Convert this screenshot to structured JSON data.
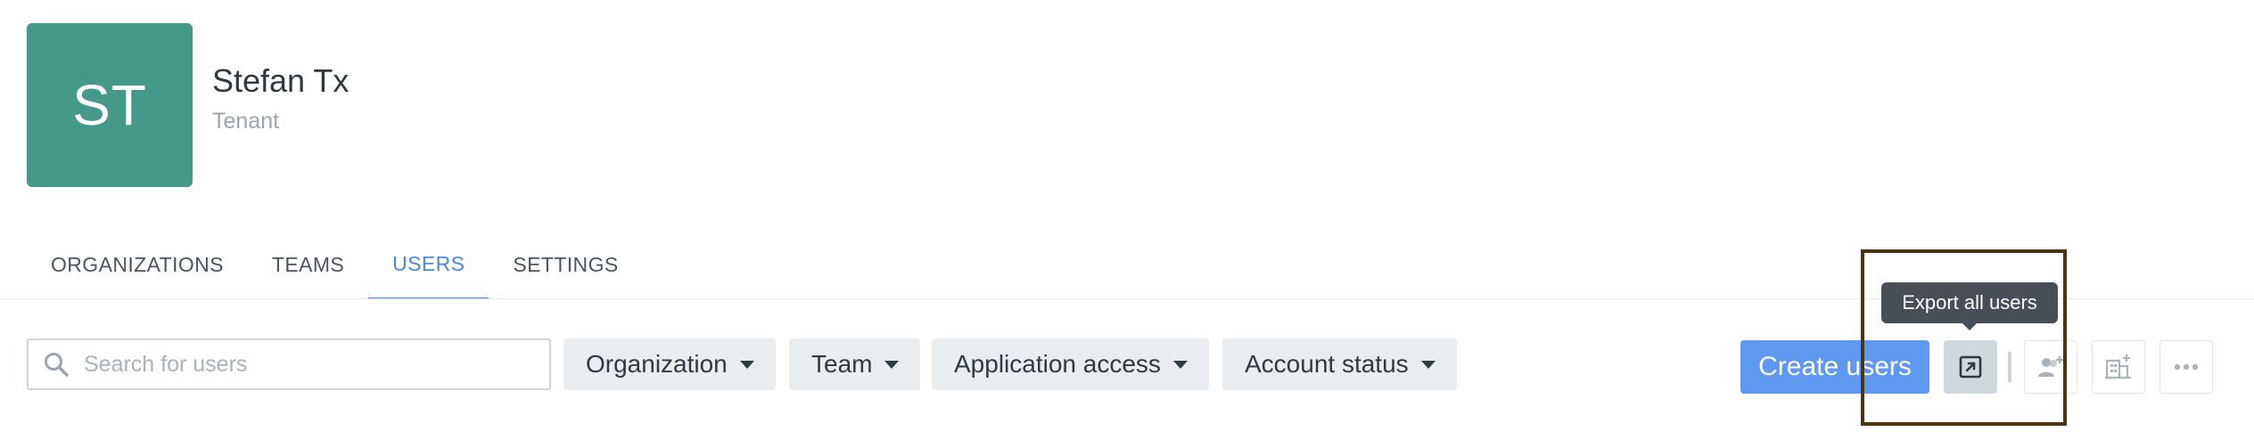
{
  "tenant": {
    "initials": "ST",
    "name": "Stefan Tx",
    "type": "Tenant",
    "avatar_color": "#44998a"
  },
  "tabs": [
    {
      "label": "ORGANIZATIONS",
      "active": false
    },
    {
      "label": "TEAMS",
      "active": false
    },
    {
      "label": "USERS",
      "active": true
    },
    {
      "label": "SETTINGS",
      "active": false
    }
  ],
  "search": {
    "placeholder": "Search for users",
    "value": "",
    "icon": "search-icon"
  },
  "filters": [
    {
      "label": "Organization"
    },
    {
      "label": "Team"
    },
    {
      "label": "Application access"
    },
    {
      "label": "Account status"
    }
  ],
  "actions": {
    "create_label": "Create users",
    "export_tooltip": "Export all users",
    "export_icon": "export-icon",
    "add_user_icon": "add-user-icon",
    "add_organization_icon": "add-organization-icon",
    "more_icon": "more-icon"
  },
  "colors": {
    "accent": "#4a87dd",
    "primary_button": "#5e98f0",
    "filter_bg": "#e9edef",
    "tooltip_bg": "#474e55",
    "highlight_border": "#4a3515"
  }
}
